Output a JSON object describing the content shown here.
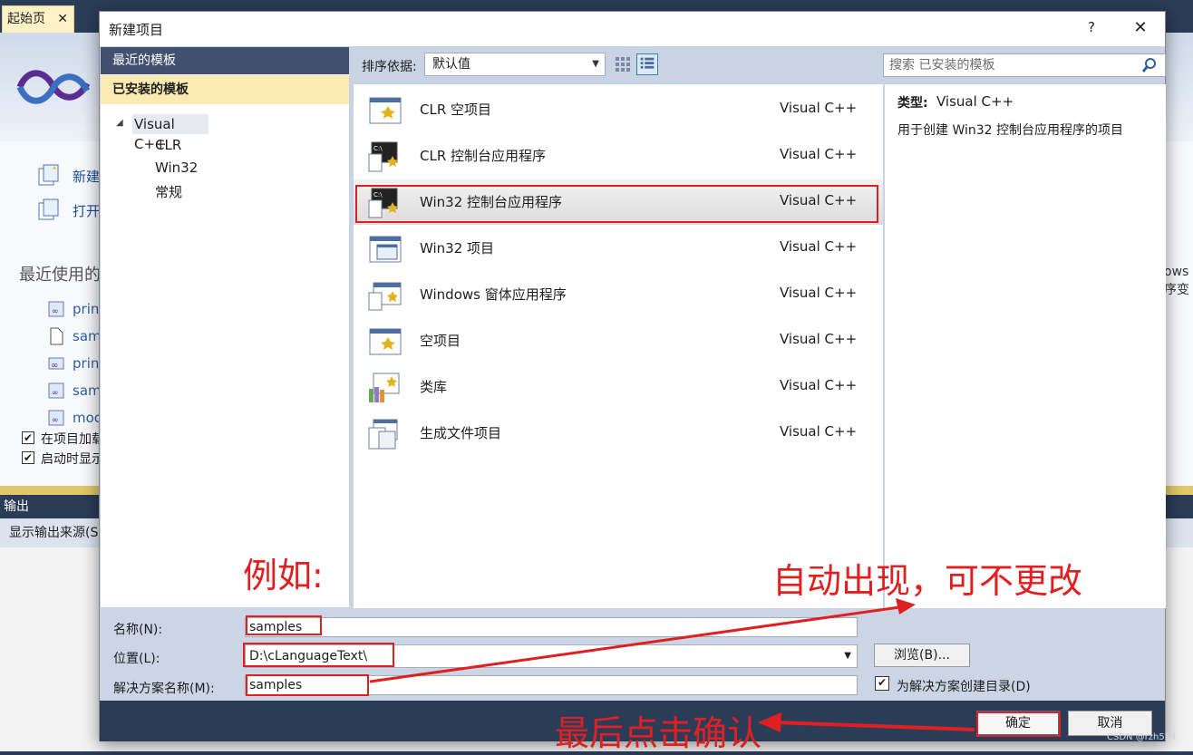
{
  "ide": {
    "start_tab": "起始页",
    "tab_close": "✕",
    "links": [
      "新建",
      "打开"
    ],
    "recent_title": "最近使用的",
    "recent_items": [
      "print",
      "sam",
      "print",
      "sam",
      "moc"
    ],
    "checkboxes": [
      "在项目加载",
      "启动时显示"
    ],
    "right_text_1": "ows",
    "right_text_2": "序变",
    "output_title": "输出",
    "output_source": "显示输出来源(S"
  },
  "dialog": {
    "title": "新建项目",
    "help": "?",
    "close": "✕",
    "left": {
      "recent": "最近的模板",
      "installed": "已安装的模板",
      "tree_root": "Visual C++",
      "tree_children": [
        "CLR",
        "Win32",
        "常规"
      ]
    },
    "toolbar": {
      "sort_label": "排序依据:",
      "sort_value": "默认值",
      "search_placeholder": "搜索 已安装的模板"
    },
    "templates": [
      {
        "name": "CLR 空项目",
        "lang": "Visual C++",
        "icon": "clr-empty-icon"
      },
      {
        "name": "CLR 控制台应用程序",
        "lang": "Visual C++",
        "icon": "console-icon"
      },
      {
        "name": "Win32 控制台应用程序",
        "lang": "Visual C++",
        "icon": "console-icon",
        "selected": true
      },
      {
        "name": "Win32 项目",
        "lang": "Visual C++",
        "icon": "window-icon"
      },
      {
        "name": "Windows 窗体应用程序",
        "lang": "Visual C++",
        "icon": "forms-icon"
      },
      {
        "name": "空项目",
        "lang": "Visual C++",
        "icon": "empty-project-icon"
      },
      {
        "name": "类库",
        "lang": "Visual C++",
        "icon": "library-icon"
      },
      {
        "name": "生成文件项目",
        "lang": "Visual C++",
        "icon": "makefile-icon"
      }
    ],
    "description": {
      "type_label": "类型:",
      "type_value": "Visual C++",
      "text": "用于创建 Win32 控制台应用程序的项目"
    },
    "form": {
      "name_label": "名称(N):",
      "name_value": "samples",
      "location_label": "位置(L):",
      "location_value": "D:\\cLanguageText\\",
      "solution_label": "解决方案名称(M):",
      "solution_value": "samples",
      "browse": "浏览(B)...",
      "create_dir": "为解决方案创建目录(D)"
    },
    "ok": "确定",
    "cancel": "取消"
  },
  "annotations": {
    "example": "例如:",
    "auto_appear": "自动出现，可不更改",
    "click_confirm": "最后点击确认"
  },
  "watermark": "CSDN @rzh554",
  "colors": {
    "annotation_red": "#e02020",
    "dialog_header": "#425170",
    "installed_highlight": "#fbeab2"
  }
}
